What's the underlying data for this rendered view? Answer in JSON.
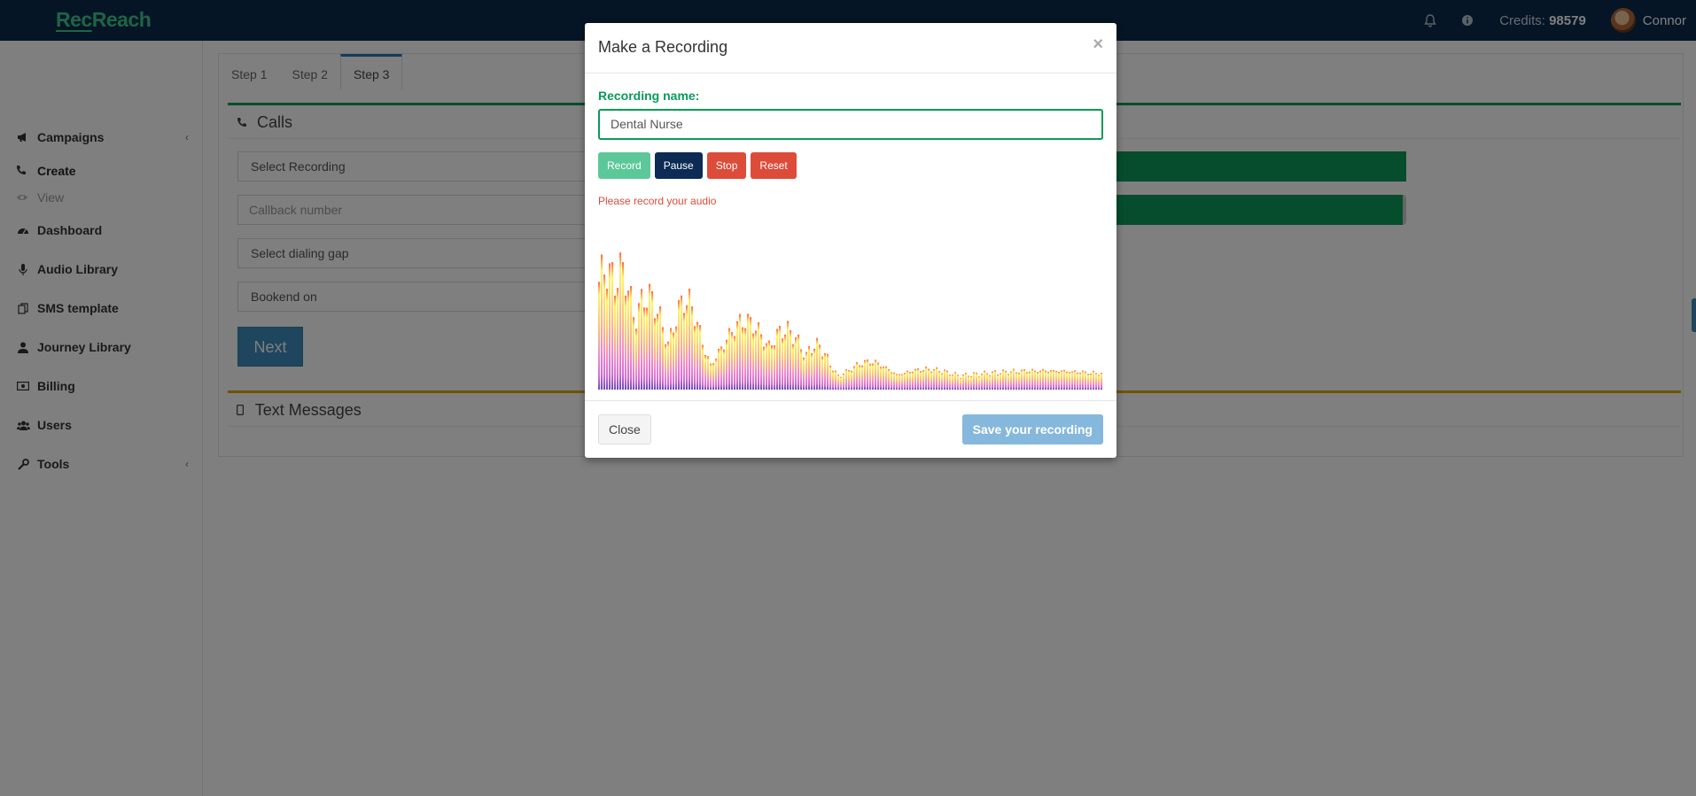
{
  "app": {
    "logo_rec": "Rec",
    "logo_reach": "Reach"
  },
  "topbar": {
    "bell_icon": "bell-icon",
    "info_icon": "info-icon",
    "credits_label": "Credits:",
    "credits_value": "98579",
    "username": "Connor"
  },
  "sidebar": {
    "items": [
      {
        "label": "Campaigns",
        "icon": "bullhorn-icon"
      },
      {
        "label": "Create",
        "icon": "phone-icon"
      },
      {
        "label": "View",
        "icon": "eye-icon"
      },
      {
        "label": "Dashboard",
        "icon": "dashboard-icon"
      },
      {
        "label": "Audio Library",
        "icon": "microphone-icon"
      },
      {
        "label": "SMS template",
        "icon": "copy-icon"
      },
      {
        "label": "Journey Library",
        "icon": "user-tie-icon"
      },
      {
        "label": "Billing",
        "icon": "money-icon"
      },
      {
        "label": "Users",
        "icon": "users-icon"
      },
      {
        "label": "Tools",
        "icon": "wrench-icon"
      }
    ]
  },
  "main": {
    "tabs": [
      "Step 1",
      "Step 2",
      "Step 3"
    ],
    "active_tab": "Step 3",
    "calls_title": "Calls",
    "fields": {
      "select_recording": "Select Recording",
      "callback_placeholder": "Callback number",
      "dialing_gap": "Select dialing gap",
      "bookend": "Bookend on"
    },
    "next_label": "Next",
    "text_messages_title": "Text Messages"
  },
  "modal": {
    "title": "Make a Recording",
    "close_x": "×",
    "name_label": "Recording name:",
    "name_value": "Dental Nurse",
    "buttons": {
      "record": "Record",
      "pause": "Pause",
      "stop": "Stop",
      "reset": "Reset"
    },
    "error": "Please record your audio",
    "footer": {
      "close": "Close",
      "save": "Save your recording"
    }
  },
  "colors": {
    "topbar": "#0a2a4a",
    "brand_green": "#0a9a5a",
    "danger": "#dd4b39",
    "primary": "#3c8dbc"
  }
}
